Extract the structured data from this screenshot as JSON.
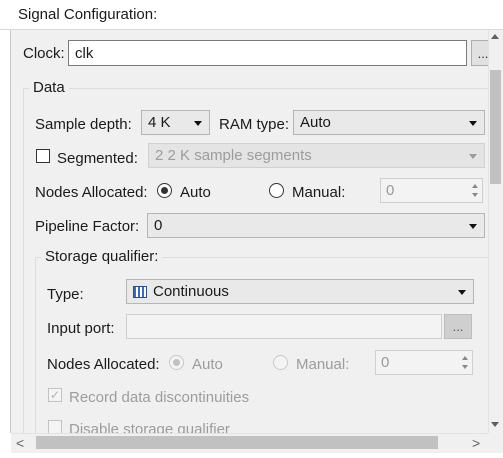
{
  "window": {
    "title": "Signal Configuration:"
  },
  "clock": {
    "label": "Clock:",
    "value": "clk",
    "browse_label": "..."
  },
  "data_group": {
    "title": "Data",
    "sample_depth_label": "Sample depth:",
    "sample_depth_value": "4 K",
    "ram_type_label": "RAM type:",
    "ram_type_value": "Auto",
    "segmented_label": "Segmented:",
    "segmented_checked": false,
    "segments_value": "2  2 K sample segments",
    "nodes_allocated_label": "Nodes Allocated:",
    "nodes_auto_label": "Auto",
    "nodes_manual_label": "Manual:",
    "nodes_manual_value": "0",
    "nodes_selected": "Auto",
    "pipeline_label": "Pipeline Factor:",
    "pipeline_value": "0"
  },
  "storage_group": {
    "title": "Storage qualifier:",
    "type_label": "Type:",
    "type_value": "Continuous",
    "type_icon": "continuous-icon",
    "input_port_label": "Input port:",
    "input_port_value": "",
    "input_port_browse_label": "...",
    "nodes_allocated_label": "Nodes Allocated:",
    "nodes_auto_label": "Auto",
    "nodes_manual_label": "Manual:",
    "nodes_manual_value": "0",
    "nodes_selected": "Auto",
    "record_discontinuities_label": "Record data discontinuities",
    "record_discontinuities_checked": true,
    "disable_qualifier_label": "Disable storage qualifier",
    "disable_qualifier_checked": false
  },
  "scrollbars": {
    "left_arrow": "<",
    "right_arrow": ">"
  }
}
